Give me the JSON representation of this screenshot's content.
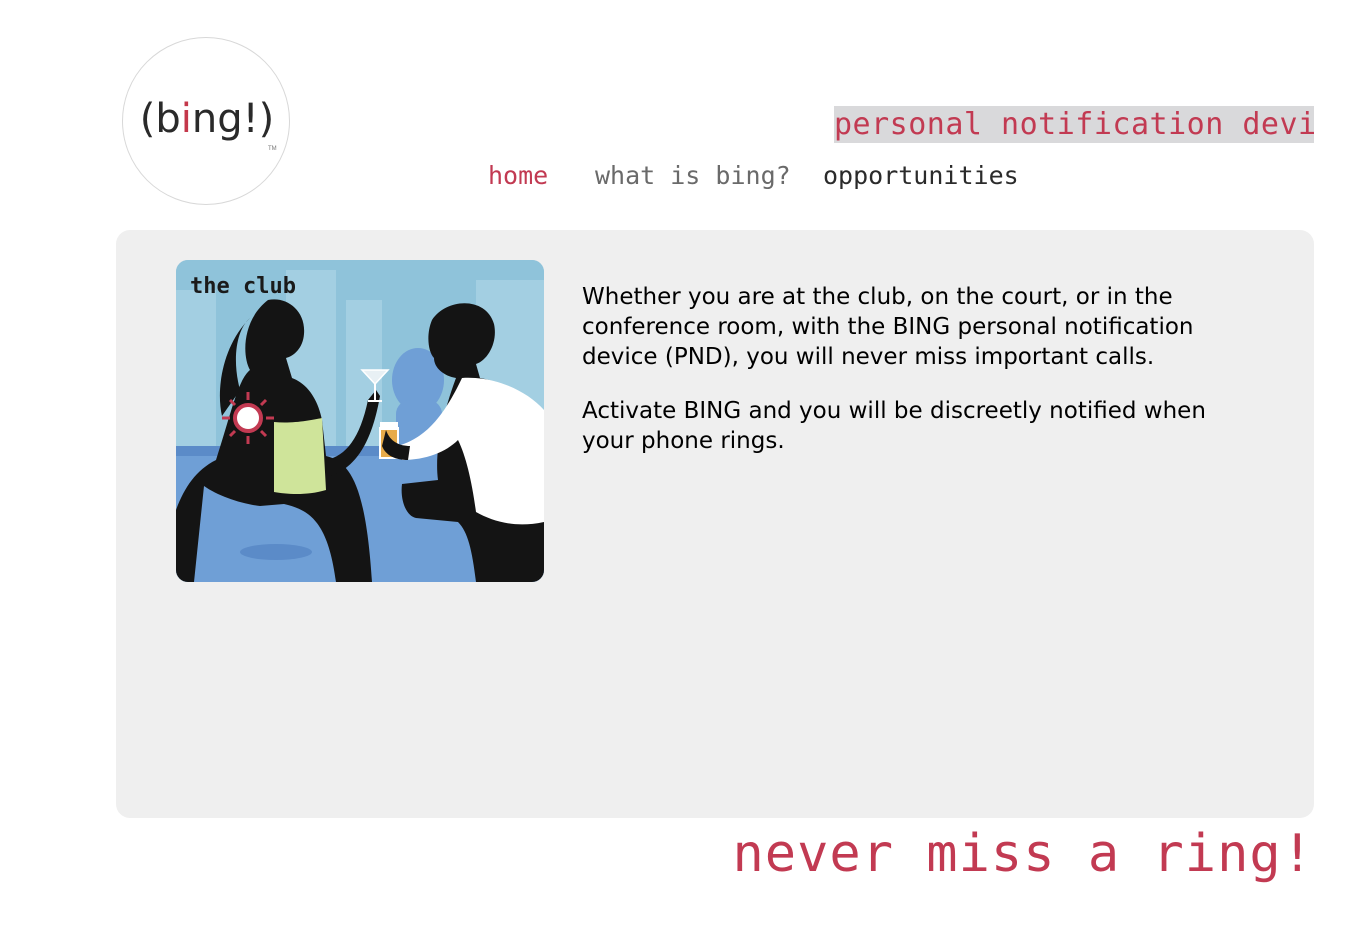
{
  "logo": {
    "text_before": "(b",
    "text_dot": "i",
    "text_after": "ng!)",
    "trademark": "TM"
  },
  "tagline": "personal notification device",
  "nav": {
    "home": "home",
    "what": "what is bing?",
    "opportunities": "opportunities"
  },
  "content": {
    "illustration_label": "the club",
    "paragraph1": "Whether you are at the club, on the court, or in the conference room, with the BING personal notification device (PND), you will never miss important calls.",
    "paragraph2": "Activate BING and you will be discreetly notified when your phone rings."
  },
  "slogan": "never miss a ring!",
  "colors": {
    "brand_red": "#c23a52",
    "panel_bg": "#efefef",
    "tagline_bg": "#d9d9db"
  }
}
